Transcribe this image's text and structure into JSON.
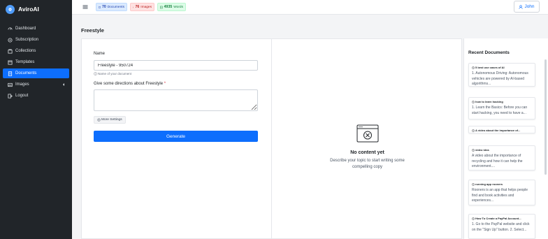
{
  "app": {
    "name": "AviroAI"
  },
  "sidebar": {
    "items": [
      {
        "label": "Dashboard",
        "icon": "dashboard-icon",
        "active": false
      },
      {
        "label": "Subscription",
        "icon": "subscription-icon",
        "active": false
      },
      {
        "label": "Collections",
        "icon": "collections-icon",
        "active": false
      },
      {
        "label": "Templates",
        "icon": "templates-icon",
        "active": false
      },
      {
        "label": "Documents",
        "icon": "documents-icon",
        "active": true
      },
      {
        "label": "Images",
        "icon": "images-icon",
        "active": false
      },
      {
        "label": "Logout",
        "icon": "logout-icon",
        "active": false
      }
    ]
  },
  "header": {
    "stats": {
      "documents_count": "70",
      "documents_label": "Documents",
      "images_count": "76",
      "images_label": "Images",
      "words_count": "4935",
      "words_label": "Words"
    },
    "user": "John"
  },
  "page": {
    "title": "Freestyle"
  },
  "form": {
    "name_label": "Name",
    "name_value": "Freestyle - 950724",
    "name_hint": "Name of your document",
    "directions_label": "Give some directions about Freestyle",
    "directions_required": "*",
    "directions_value": "",
    "more_settings": "More Settings",
    "generate": "Generate"
  },
  "output": {
    "empty_title": "No content yet",
    "empty_subtitle": "Describe your topic to start writing some compelling copy"
  },
  "recent": {
    "title": "Recent Documents",
    "docs": [
      {
        "title": "5 best use cases of AI",
        "body": "1. Autonomous Driving: Autonomous vehicles are powered by AI-based algorithms..."
      },
      {
        "title": "how to learn hacking",
        "body": "1. Learn the Basics: Before you can start hacking, you need to have a..."
      },
      {
        "title": "A video about the importance of...",
        "body": ""
      },
      {
        "title": "video idea",
        "body": "A video about the importance of recycling and how it can help the environment...."
      },
      {
        "title": "running app rooners",
        "body": "Rooners is an app that helps people find and book activities and experiences..."
      },
      {
        "title": "How To Create a PayPal Account...",
        "body": "1. Go to the PayPal website and click on the \"Sign Up\" button. 2. Select..."
      }
    ]
  },
  "colors": {
    "primary": "#0d6efd",
    "sidebar_bg": "#212529",
    "required": "#dc3545"
  }
}
